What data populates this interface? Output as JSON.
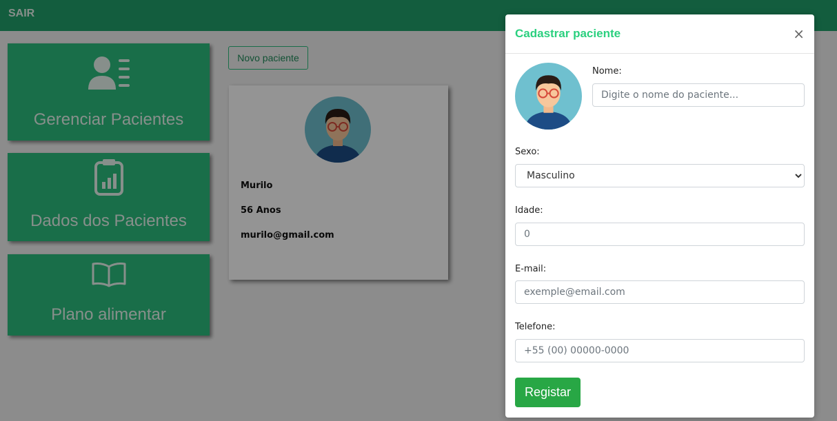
{
  "topbar": {
    "exit_label": "SAIR"
  },
  "menu": {
    "manage_label": "Gerenciar Pacientes",
    "data_label": "Dados dos Pacientes",
    "plan_label": "Plano alimentar"
  },
  "actions": {
    "new_patient_label": "Novo paciente"
  },
  "patient": {
    "name": "Murilo",
    "age": "56 Anos",
    "email": "murilo@gmail.com"
  },
  "modal": {
    "title": "Cadastrar paciente",
    "close_glyph": "×",
    "name_label": "Nome:",
    "name_placeholder": "Digite o nome do paciente...",
    "sex_label": "Sexo:",
    "sex_value": "Masculino",
    "age_label": "Idade:",
    "age_placeholder": "0",
    "email_label": "E-mail:",
    "email_placeholder": "exemple@email.com",
    "phone_label": "Telefone:",
    "phone_placeholder": "+55 (00) 00000-0000",
    "submit_label": "Registar"
  },
  "icons": {
    "manage": "user-list-icon",
    "data": "clipboard-chart-icon",
    "plan": "open-book-icon",
    "avatar": "patient-avatar-icon",
    "close": "close-icon"
  },
  "colors": {
    "topbar": "#22a06b",
    "card": "#2bbd7e",
    "title": "#2bd07f",
    "submit": "#28a745"
  }
}
